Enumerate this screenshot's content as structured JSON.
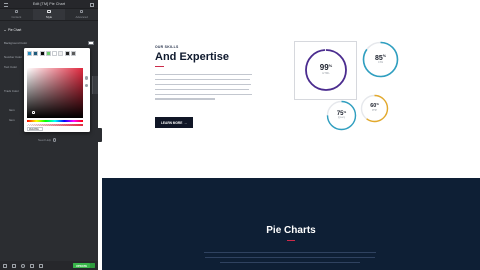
{
  "editor": {
    "title": "Edit [TM] Pie Chart",
    "tabs": [
      {
        "label": "Content"
      },
      {
        "label": "Style"
      },
      {
        "label": "Advanced"
      }
    ],
    "section_title": "Pie Chart",
    "controls": [
      {
        "label": "Background Color"
      },
      {
        "label": "Number Color"
      },
      {
        "label": "Text Color"
      },
      {
        "label": "Track Color"
      },
      {
        "label": "Item"
      },
      {
        "label": "Item"
      }
    ],
    "color_picker": {
      "presets": [
        "#2a8fbf",
        "#1e5a7a",
        "#0a0a0a",
        "#6ccf6f",
        "#ffffff",
        "#f0f0f0",
        "#222222",
        "#5c5c5c"
      ],
      "hex_value": "#E0283E",
      "selected_color": "#e0283e"
    },
    "need_help": "Need Help",
    "footer": {
      "update_label": "UPDATE"
    }
  },
  "skills": {
    "eyebrow": "OUR SKILLS",
    "headline": "And Expertise",
    "button_label": "LEARN MORE",
    "button_arrow": "→",
    "pies": [
      {
        "value": "99",
        "unit": "%",
        "label": "HTML",
        "percent": 99,
        "color": "#4b2c8f"
      },
      {
        "value": "85",
        "unit": "%",
        "label": "CSS",
        "percent": 85,
        "color": "#2f9fc0"
      },
      {
        "value": "75",
        "unit": "%",
        "label": "jQuery",
        "percent": 75,
        "color": "#2f9fc0"
      },
      {
        "value": "60",
        "unit": "%",
        "label": "PHP",
        "percent": 60,
        "color": "#e3a92b"
      }
    ]
  },
  "dark_section": {
    "title": "Pie Charts"
  },
  "colors": {
    "accent": "#cc2b4a",
    "dark_bg": "#0e1f35",
    "panel_bg": "#2b2d31",
    "update_green": "#39b54a"
  }
}
